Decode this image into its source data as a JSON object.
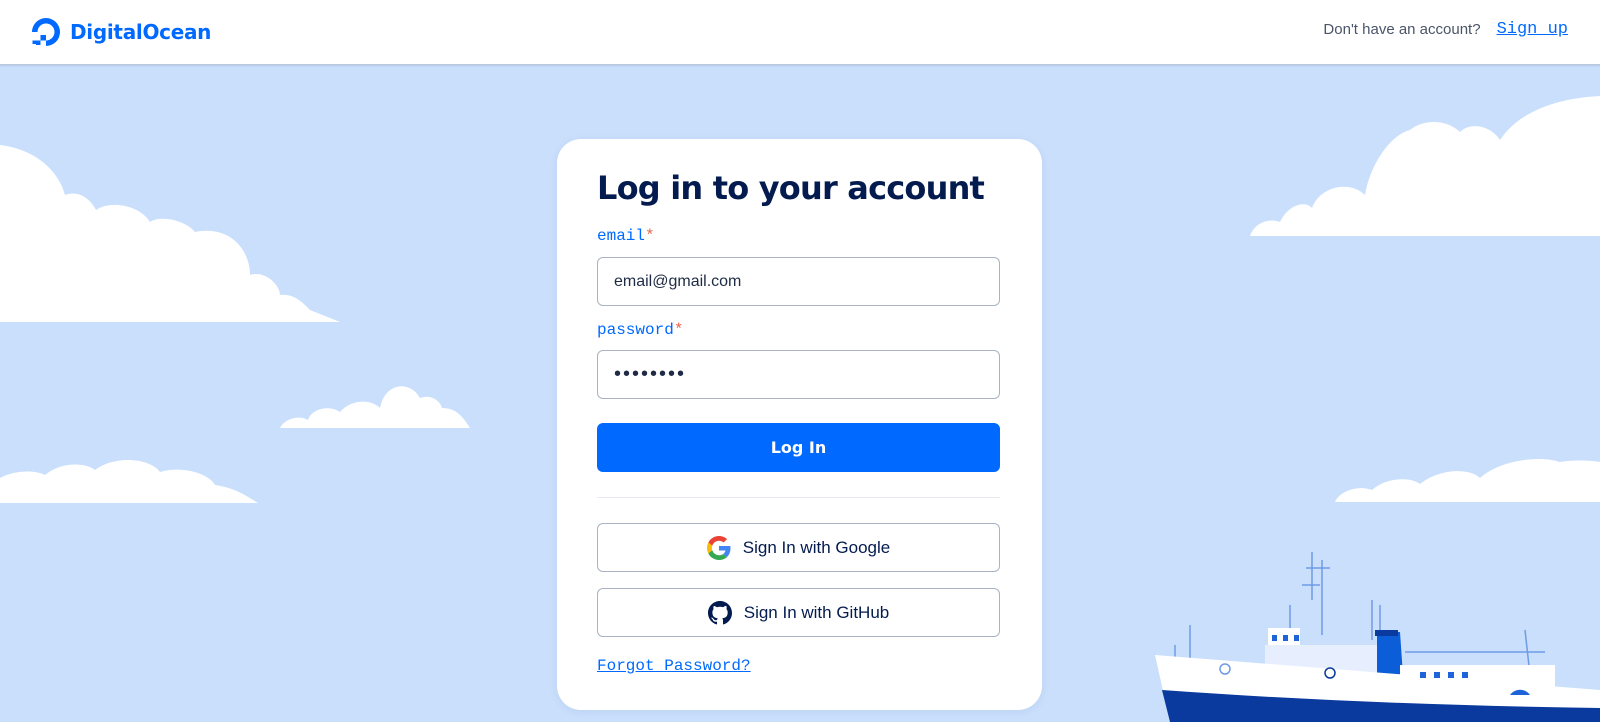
{
  "brand": {
    "name": "DigitalOcean",
    "color": "#0069ff"
  },
  "header": {
    "prompt": "Don't have an account?",
    "signup_label": "Sign up"
  },
  "login": {
    "title": "Log in to your account",
    "email": {
      "label": "email",
      "required_mark": "*",
      "value": "email@gmail.com"
    },
    "password": {
      "label": "password",
      "required_mark": "*",
      "value": "••••••••"
    },
    "submit_label": "Log In",
    "google_label": "Sign In with Google",
    "github_label": "Sign In with GitHub",
    "forgot_label": "Forgot Password?"
  },
  "colors": {
    "background": "#c9dffc",
    "primary": "#0069ff",
    "title": "#031b4e",
    "required": "#e8614a"
  }
}
